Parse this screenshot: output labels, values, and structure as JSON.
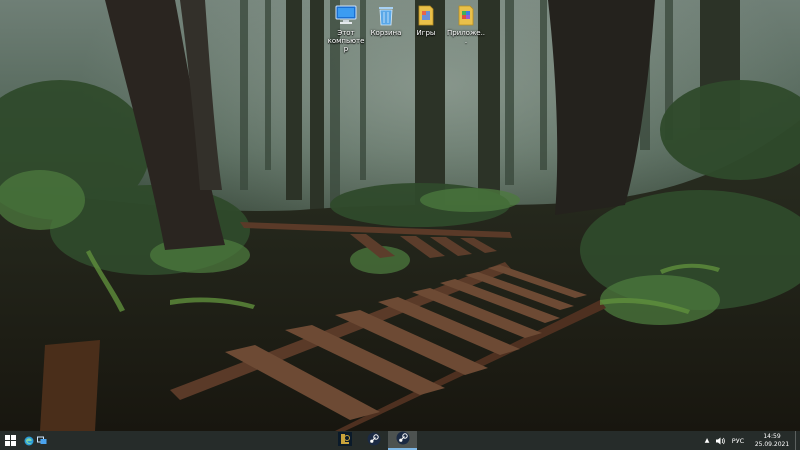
{
  "desktop": {
    "icons": [
      {
        "label": "Этот компьютер",
        "icon": "computer-icon"
      },
      {
        "label": "Корзина",
        "icon": "recycle-bin-icon"
      },
      {
        "label": "Игры",
        "icon": "folder-icon"
      },
      {
        "label": "Приложе...",
        "icon": "folder-apps-icon"
      }
    ]
  },
  "taskbar": {
    "start_icon": "windows-logo-icon",
    "quick_launch": [
      "edge-icon",
      "task-view-icon"
    ],
    "pinned": [
      {
        "icon": "league-of-legends-icon",
        "active": false
      },
      {
        "icon": "steam-icon",
        "active": false
      },
      {
        "icon": "steam-icon",
        "active": true
      }
    ],
    "tray": {
      "overflow_glyph": "▲",
      "language": "РУС",
      "time": "14:59",
      "date": "25.09.2021"
    }
  },
  "colors": {
    "taskbar": "#2b2f2d",
    "accent": "#7fb8e6",
    "folder": "#e9c04a"
  }
}
